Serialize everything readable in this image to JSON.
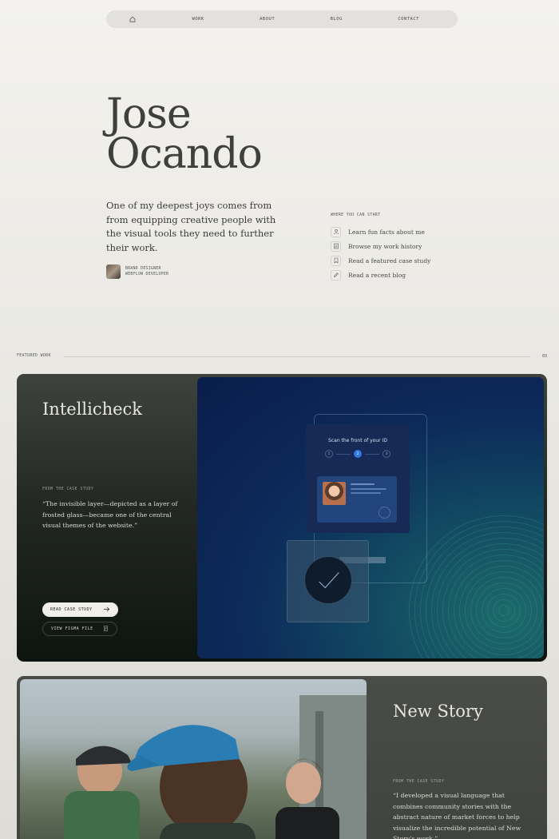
{
  "nav": {
    "home_icon": "home-icon",
    "items": [
      "WORK",
      "ABOUT",
      "BLOG",
      "CONTACT"
    ]
  },
  "hero": {
    "first_name": "Jose",
    "last_name": "Ocando",
    "intro": "One of my deepest joys comes from from equipping creative people with the visual tools they need to further their work.",
    "roles": [
      "BRAND DESIGNER",
      "WEBFLOW DEVELOPER"
    ]
  },
  "start": {
    "header": "WHERE YOU CAN START",
    "items": [
      {
        "label": "Learn fun facts about me",
        "icon": "person-icon"
      },
      {
        "label": "Browse my work history",
        "icon": "document-icon"
      },
      {
        "label": "Read a featured case study",
        "icon": "bookmark-icon"
      },
      {
        "label": "Read a recent blog",
        "icon": "pencil-icon"
      }
    ]
  },
  "featured": {
    "label": "FEATURED WORK",
    "count": "03"
  },
  "cards": [
    {
      "title": "Intellicheck",
      "quote_label": "FROM THE CASE STUDY",
      "quote": "“The invisible layer—depicted as a layer of frosted glass—became one of the central visual themes of the website.”",
      "primary_button": "READ CASE STUDY",
      "secondary_button": "VIEW FIGMA FILE",
      "mockup": {
        "scan_text": "Scan the front of your ID",
        "steps": [
          "1",
          "2",
          "3"
        ],
        "active_step": 2
      }
    },
    {
      "title": "New Story",
      "quote_label": "FROM THE CASE STUDY",
      "quote": "“I developed a visual language that combines community stories with the abstract nature of market forces to help visualize the incredible potential of New Story's work.”"
    }
  ],
  "colors": {
    "accent_blue": "#2d7be0",
    "card_dark": "#232823"
  }
}
